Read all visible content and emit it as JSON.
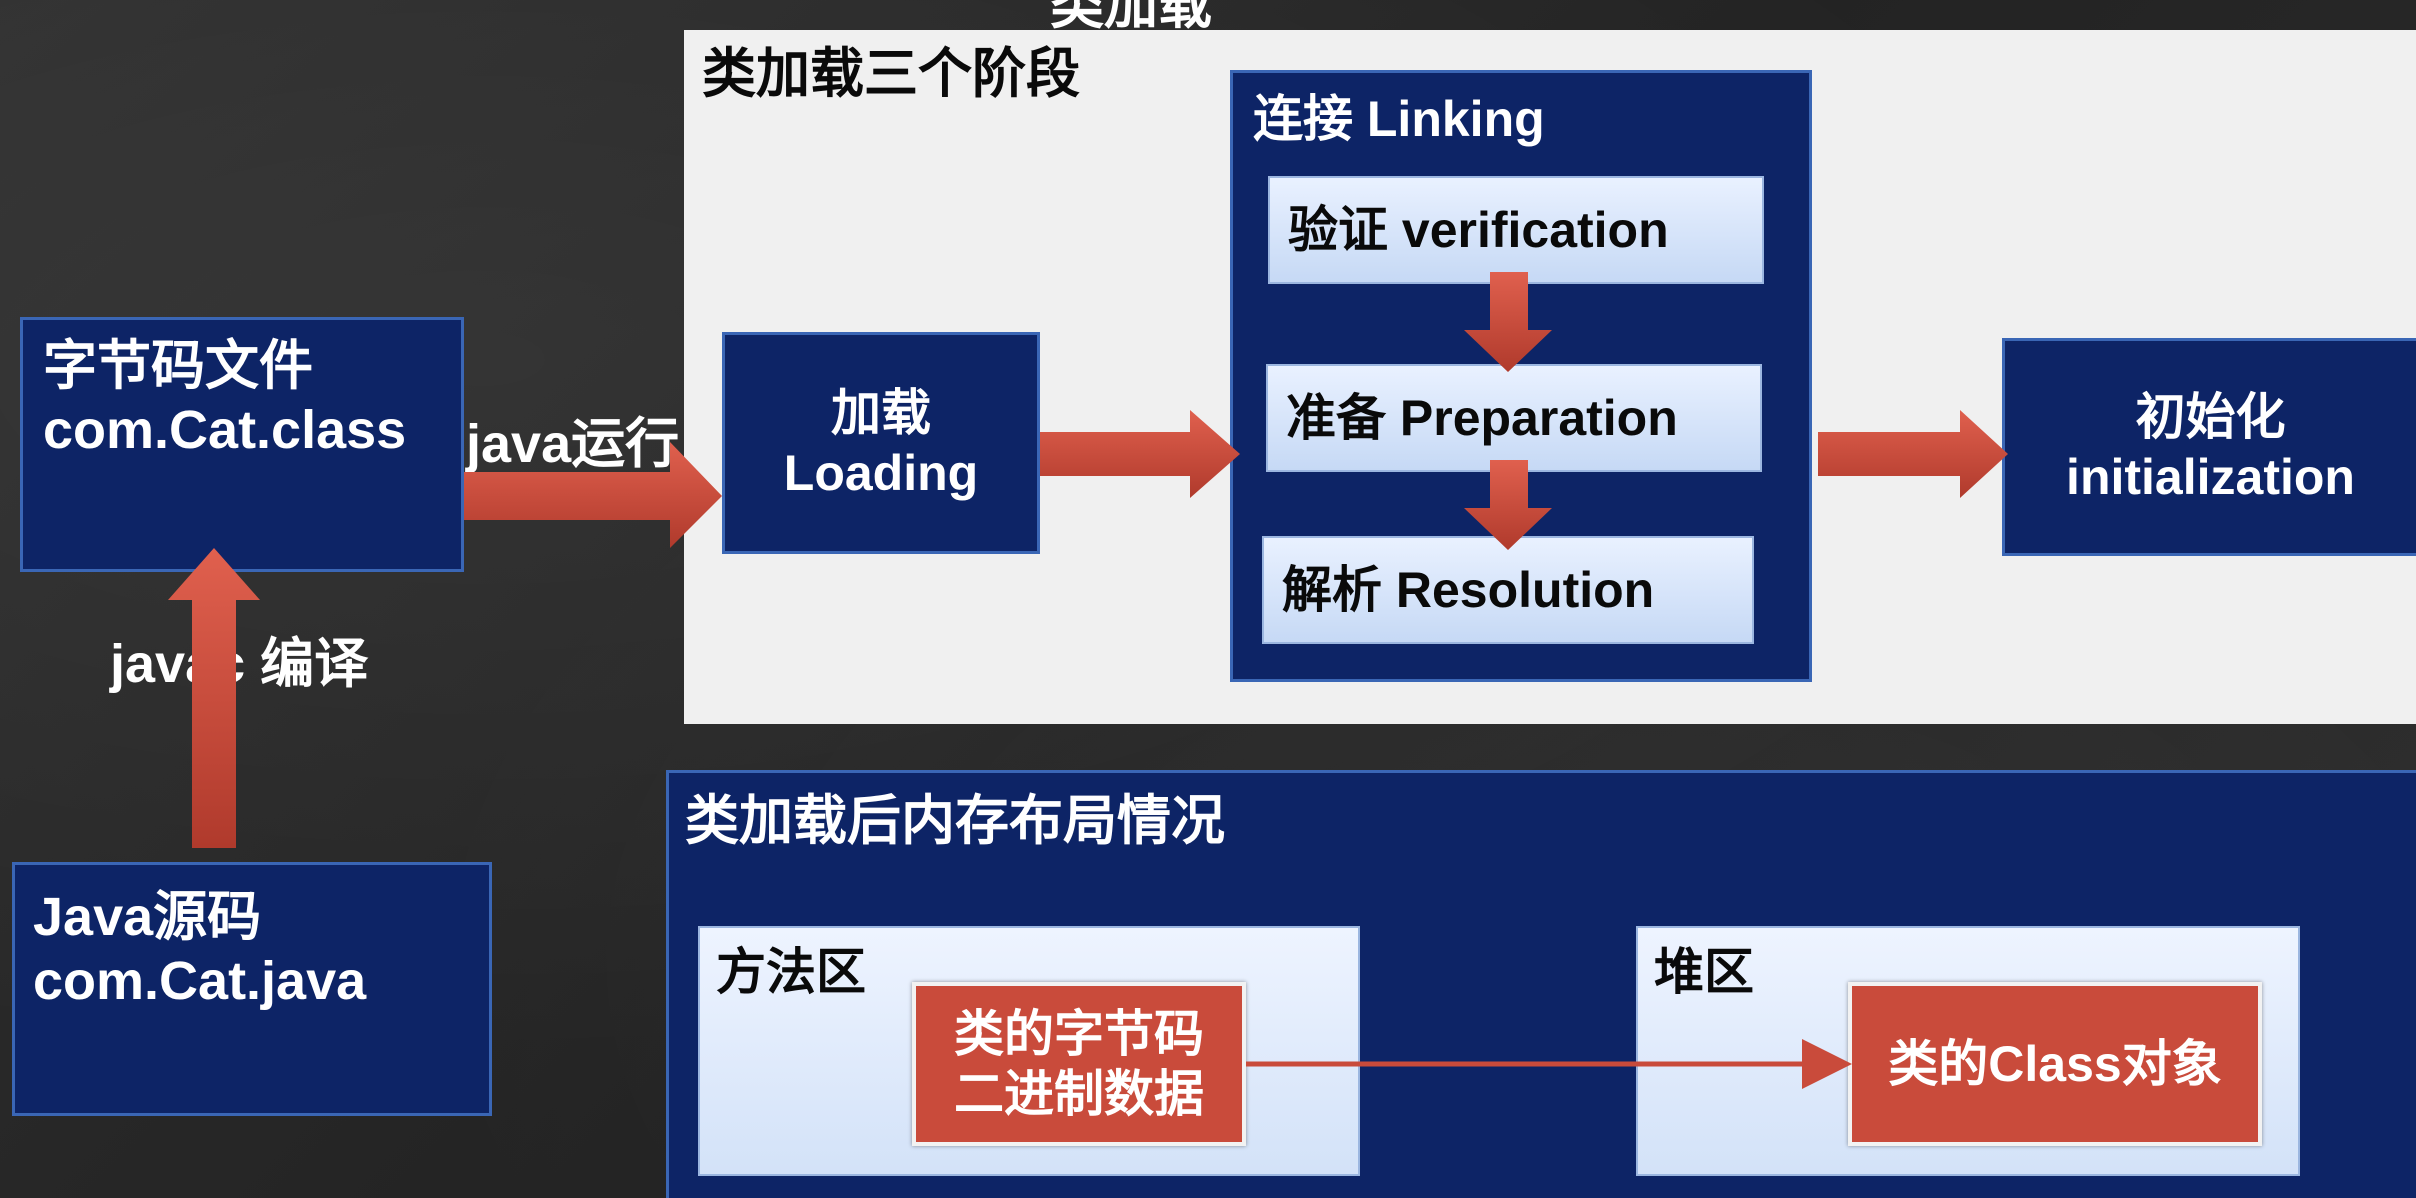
{
  "top_title": "类加载",
  "bytecode_file": {
    "line1": "字节码文件",
    "line2": "com.Cat.class"
  },
  "java_source": {
    "line1": "Java源码",
    "line2": "com.Cat.java"
  },
  "javac_label": "javac 编译",
  "java_run_label": "java运行",
  "stages_panel": {
    "title": "类加载三个阶段",
    "loading": {
      "line1": "加载",
      "line2": "Loading"
    },
    "linking": {
      "title": "连接 Linking",
      "verification": "验证 verification",
      "preparation": "准备 Preparation",
      "resolution": "解析 Resolution"
    },
    "initialization": {
      "line1": "初始化",
      "line2": "initialization"
    }
  },
  "memory_panel": {
    "title": "类加载后内存布局情况",
    "method_area": {
      "title": "方法区",
      "bytecode": {
        "line1": "类的字节码",
        "line2": "二进制数据"
      }
    },
    "heap": {
      "title": "堆区",
      "class_object": "类的Class对象"
    }
  },
  "colors": {
    "navy": "#0d2466",
    "arrow_red": "#c94b3b",
    "light_panel": "#f0f0f0",
    "light_blue": "#dbe8fb"
  }
}
